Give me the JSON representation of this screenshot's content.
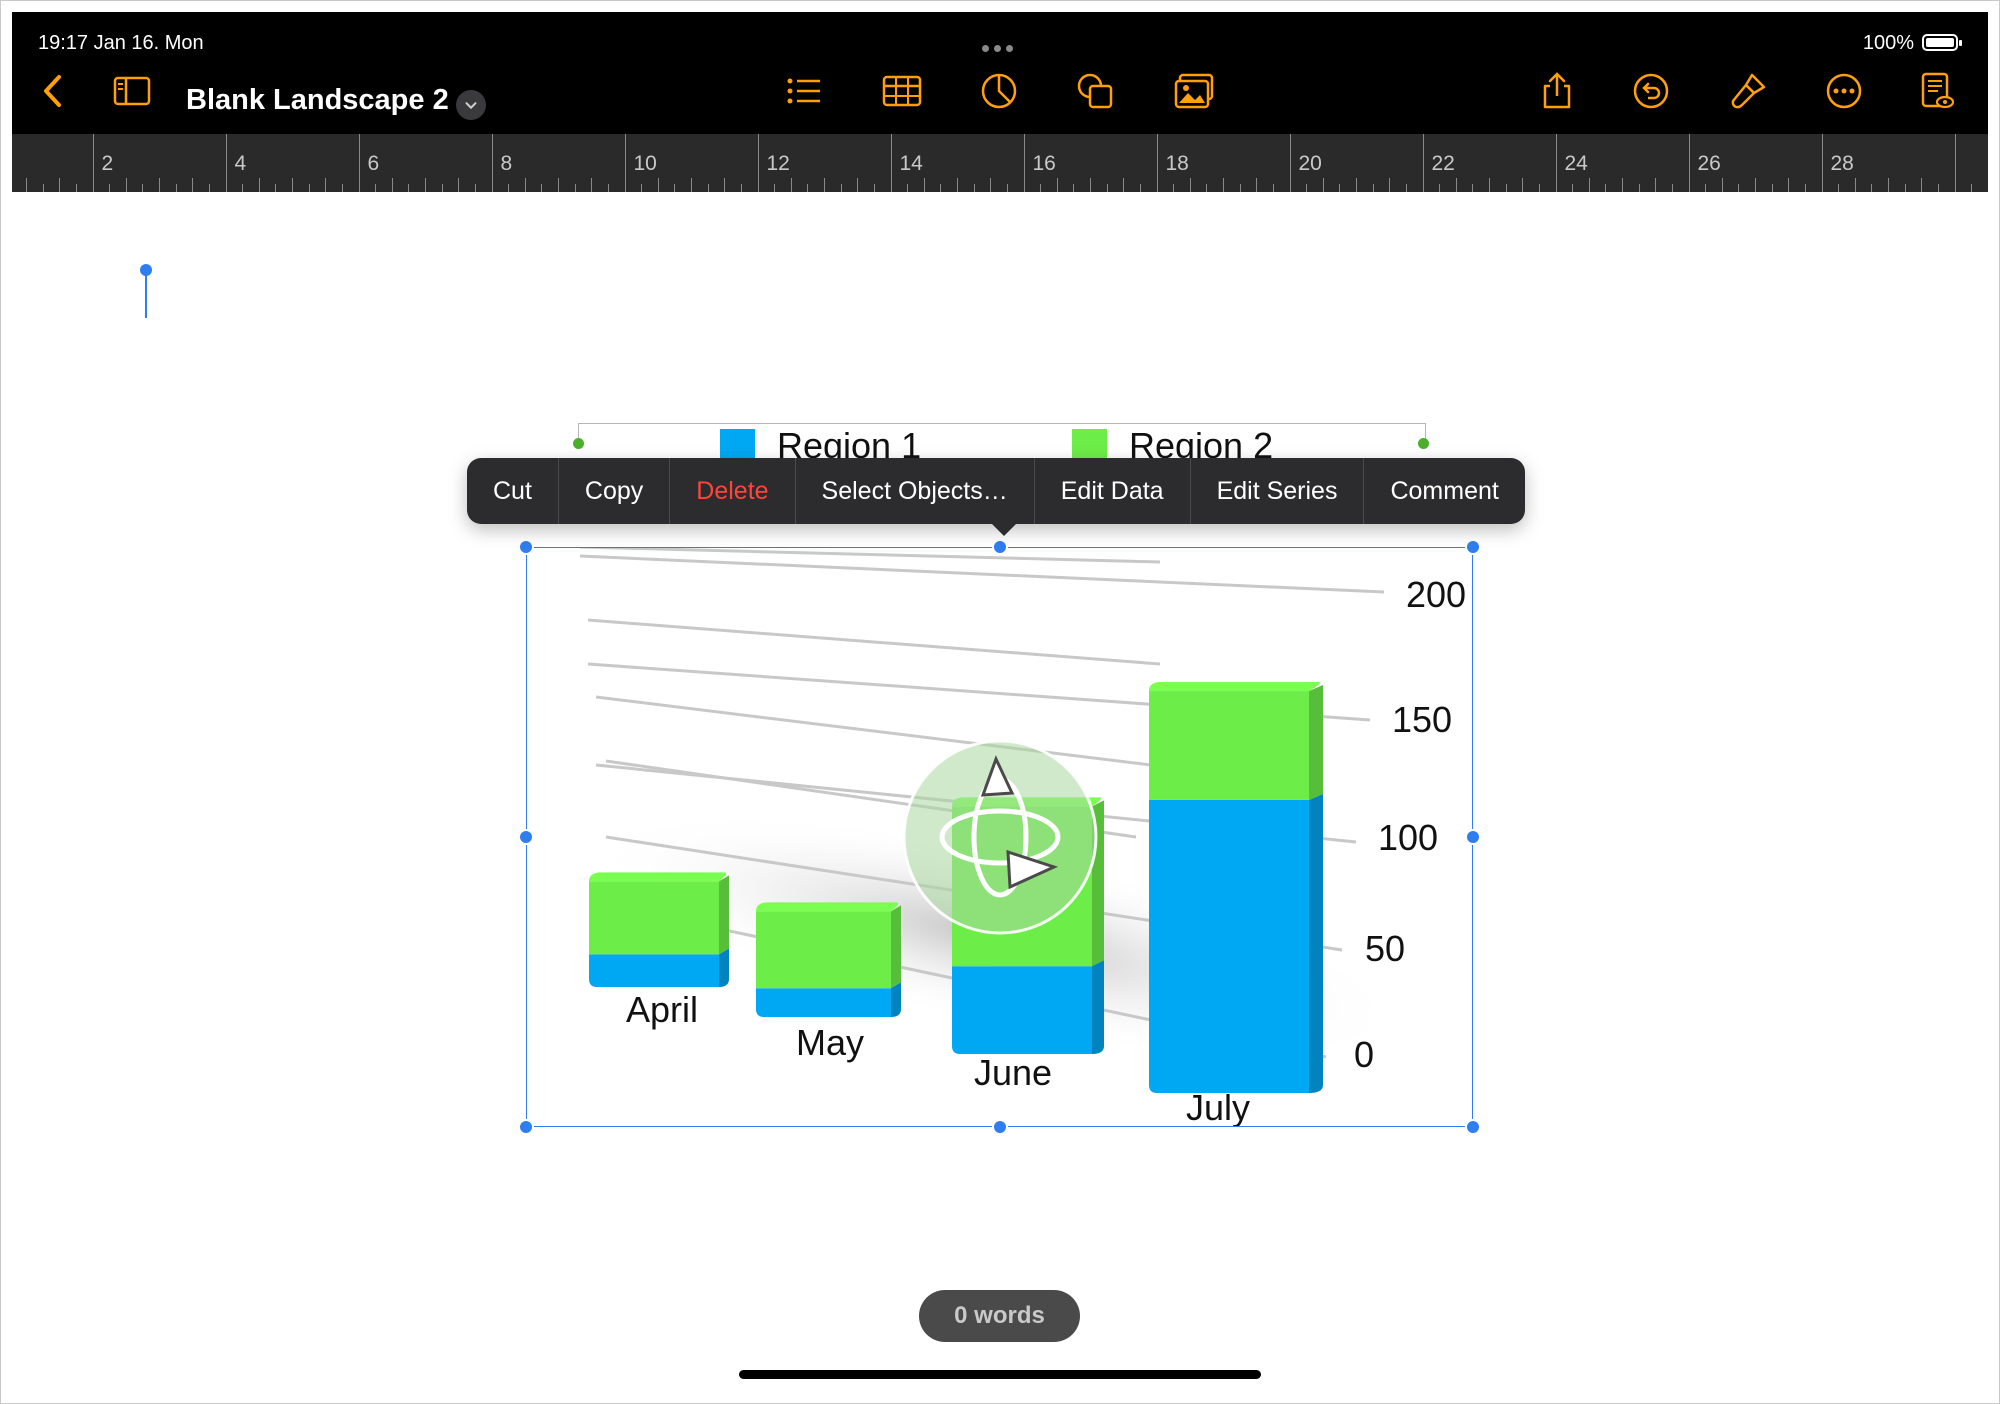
{
  "status_bar": {
    "time_date": "19:17   Jan 16. Mon",
    "battery": "100%"
  },
  "toolbar": {
    "doc_title": "Blank Landscape 2",
    "icons_left": [
      "back-chevron-icon",
      "sidebar-icon"
    ],
    "icons_center": [
      "list-icon",
      "table-icon",
      "chart-icon",
      "shapes-icon",
      "media-icon"
    ],
    "icons_right": [
      "share-icon",
      "undo-icon",
      "format-brush-icon",
      "more-icon",
      "document-view-icon"
    ],
    "accent_color": "#ff9f0a"
  },
  "ruler": {
    "labels": [
      "2",
      "4",
      "6",
      "8",
      "10",
      "12",
      "14",
      "16",
      "18",
      "20",
      "22",
      "24",
      "26",
      "28"
    ]
  },
  "context_menu": {
    "items": [
      {
        "label": "Cut",
        "destructive": false
      },
      {
        "label": "Copy",
        "destructive": false
      },
      {
        "label": "Delete",
        "destructive": true
      },
      {
        "label": "Select Objects…",
        "destructive": false
      },
      {
        "label": "Edit Data",
        "destructive": false
      },
      {
        "label": "Edit Series",
        "destructive": false
      },
      {
        "label": "Comment",
        "destructive": false
      }
    ]
  },
  "chart_data": {
    "type": "bar",
    "stacked": true,
    "three_d": true,
    "categories": [
      "April",
      "May",
      "June",
      "July"
    ],
    "series": [
      {
        "name": "Region 1",
        "color": "#00a8f3",
        "values": [
          17,
          15,
          45,
          148
        ]
      },
      {
        "name": "Region 2",
        "color": "#6ded47",
        "values": [
          38,
          40,
          82,
          55
        ]
      }
    ],
    "yticks": [
      "0",
      "50",
      "100",
      "150",
      "200"
    ],
    "ylim": [
      0,
      200
    ],
    "grid": true,
    "legend_position": "top"
  },
  "footer": {
    "word_count": "0 words"
  }
}
